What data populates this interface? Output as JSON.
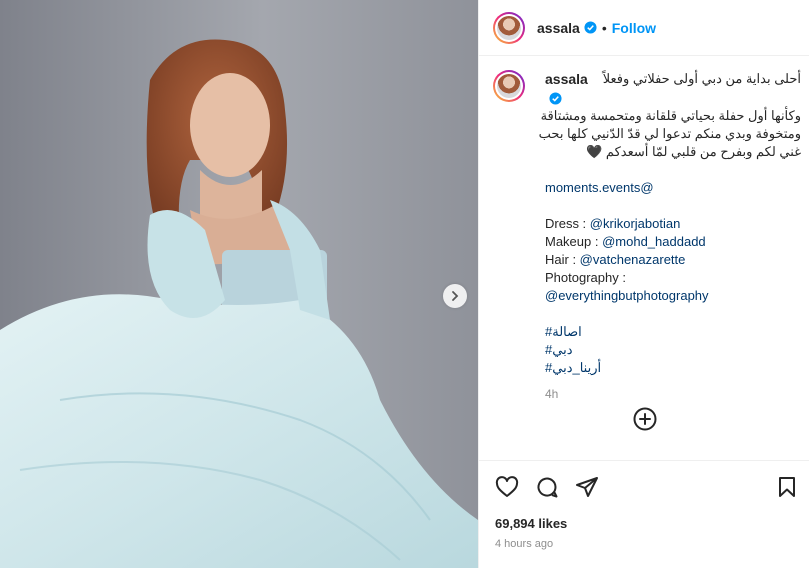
{
  "post": {
    "author": "assala",
    "follow_label": "Follow",
    "separator": "•",
    "caption_lines": [
      "أحلى بداية من دبي أولى حفلاتي وفعلاً",
      "وكأنها أول حفلة بحياتي قلقانة ومتحمسة ومشتاقة",
      "ومتخوفة وبدي منكم تدعوا لي قدّ الدّنيي كلها بحب",
      "غني لكم وبفرح من قلبي لمّا أسعدكم 🖤"
    ],
    "event_tag": "moments.events@",
    "credits": [
      {
        "label": "Dress : ",
        "handle": "@krikorjabotian"
      },
      {
        "label": "Makeup : ",
        "handle": "@mohd_haddadd"
      },
      {
        "label": "Hair : ",
        "handle": "@vatchenazarette"
      }
    ],
    "photography_label": "Photography :",
    "photography_handle": "@everythingbutphotography",
    "hashtags": [
      "#اصالة",
      "#دبي",
      "#أرينا_دبي"
    ],
    "caption_time": "4h",
    "likes": "69,894 likes",
    "posted_ago": "4 hours ago"
  },
  "colors": {
    "accent": "#0095f6",
    "link": "#00376b",
    "muted": "#8e8e8e"
  },
  "icons": [
    "verified-badge-icon",
    "chevron-right-icon",
    "add-circle-icon",
    "heart-icon",
    "comment-icon",
    "share-icon",
    "bookmark-icon"
  ]
}
